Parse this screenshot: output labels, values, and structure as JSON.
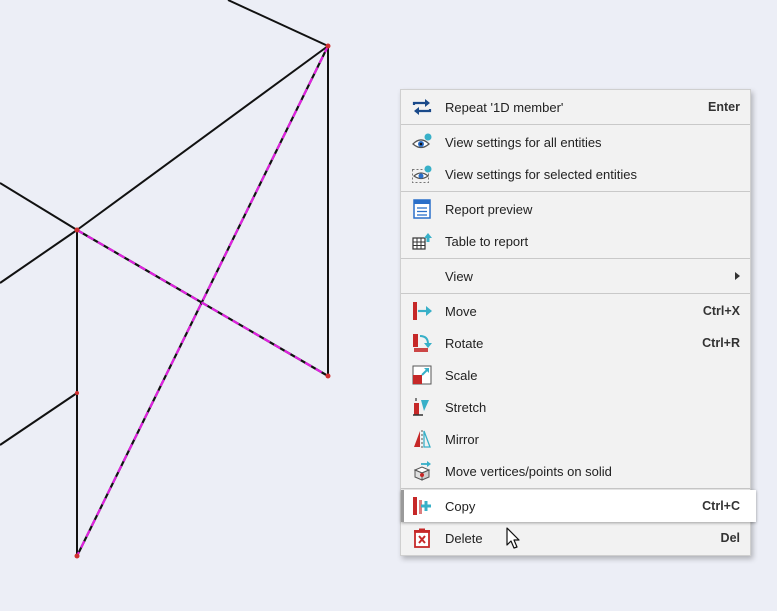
{
  "menu": {
    "groups": [
      [
        {
          "label": "Repeat '1D member'",
          "shortcut": "Enter",
          "icon": "repeat-icon"
        }
      ],
      [
        {
          "label": "View settings for all entities",
          "shortcut": "",
          "icon": "eye-settings-icon"
        },
        {
          "label": "View settings for selected entities",
          "shortcut": "",
          "icon": "eye-selected-settings-icon"
        }
      ],
      [
        {
          "label": "Report preview",
          "shortcut": "",
          "icon": "report-preview-icon"
        },
        {
          "label": "Table to report",
          "shortcut": "",
          "icon": "table-to-report-icon"
        }
      ],
      [
        {
          "label": "View",
          "shortcut": "",
          "icon": "",
          "submenu": true
        }
      ],
      [
        {
          "label": "Move",
          "shortcut": "Ctrl+X",
          "icon": "move-icon"
        },
        {
          "label": "Rotate",
          "shortcut": "Ctrl+R",
          "icon": "rotate-icon"
        },
        {
          "label": "Scale",
          "shortcut": "",
          "icon": "scale-icon"
        },
        {
          "label": "Stretch",
          "shortcut": "",
          "icon": "stretch-icon"
        },
        {
          "label": "Mirror",
          "shortcut": "",
          "icon": "mirror-icon"
        },
        {
          "label": "Move vertices/points on solid",
          "shortcut": "",
          "icon": "move-vertices-icon"
        }
      ],
      [
        {
          "label": "Copy",
          "shortcut": "Ctrl+C",
          "icon": "copy-icon",
          "hovered": true
        },
        {
          "label": "Delete",
          "shortcut": "Del",
          "icon": "delete-icon"
        }
      ]
    ]
  },
  "colors": {
    "background": "#eceef6",
    "member_line": "#111111",
    "selected_member": "#e020e0",
    "node": "#d03030"
  }
}
